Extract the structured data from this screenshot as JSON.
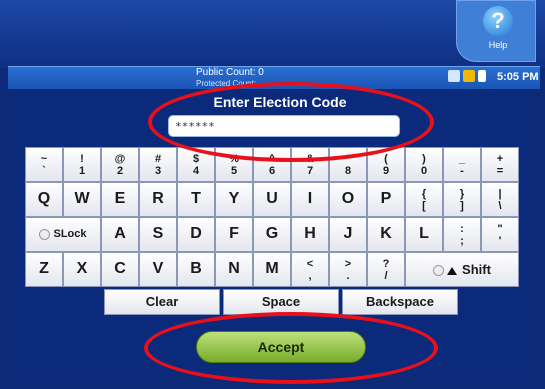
{
  "help": {
    "icon": "help-icon",
    "glyph": "?",
    "label": "Help"
  },
  "status": {
    "public_count": "Public Count: 0",
    "protected_count": "Protected Count: ...",
    "icons": [
      "printer-icon",
      "save-icon",
      "plug-icon"
    ],
    "time": "5:05 PM"
  },
  "prompt": {
    "title": "Enter Election Code",
    "value": "******"
  },
  "keyboard": {
    "row1": [
      {
        "top": "~",
        "bottom": "`"
      },
      {
        "top": "!",
        "bottom": "1"
      },
      {
        "top": "@",
        "bottom": "2"
      },
      {
        "top": "#",
        "bottom": "3"
      },
      {
        "top": "$",
        "bottom": "4"
      },
      {
        "top": "%",
        "bottom": "5"
      },
      {
        "top": "^",
        "bottom": "6"
      },
      {
        "top": "&",
        "bottom": "7"
      },
      {
        "top": "*",
        "bottom": "8"
      },
      {
        "top": "(",
        "bottom": "9"
      },
      {
        "top": ")",
        "bottom": "0"
      },
      {
        "top": "_",
        "bottom": "-"
      },
      {
        "top": "+",
        "bottom": "="
      }
    ],
    "row2_letters": [
      "Q",
      "W",
      "E",
      "R",
      "T",
      "Y",
      "U",
      "I",
      "O",
      "P"
    ],
    "row2_syms": [
      {
        "top": "{",
        "bottom": "["
      },
      {
        "top": "}",
        "bottom": "]"
      },
      {
        "top": "|",
        "bottom": "\\"
      }
    ],
    "slock": "SLock",
    "row3_letters": [
      "A",
      "S",
      "D",
      "F",
      "G",
      "H",
      "J",
      "K",
      "L"
    ],
    "row3_syms": [
      {
        "top": ":",
        "bottom": ";"
      },
      {
        "top": "\"",
        "bottom": "'"
      }
    ],
    "row4_letters": [
      "Z",
      "X",
      "C",
      "V",
      "B",
      "N",
      "M"
    ],
    "row4_syms": [
      {
        "top": "<",
        "bottom": ","
      },
      {
        "top": ">",
        "bottom": "."
      },
      {
        "top": "?",
        "bottom": "/"
      }
    ],
    "shift": "Shift",
    "clear": "Clear",
    "space": "Space",
    "backspace": "Backspace"
  },
  "accept": "Accept",
  "highlight_color": "#e8101a"
}
